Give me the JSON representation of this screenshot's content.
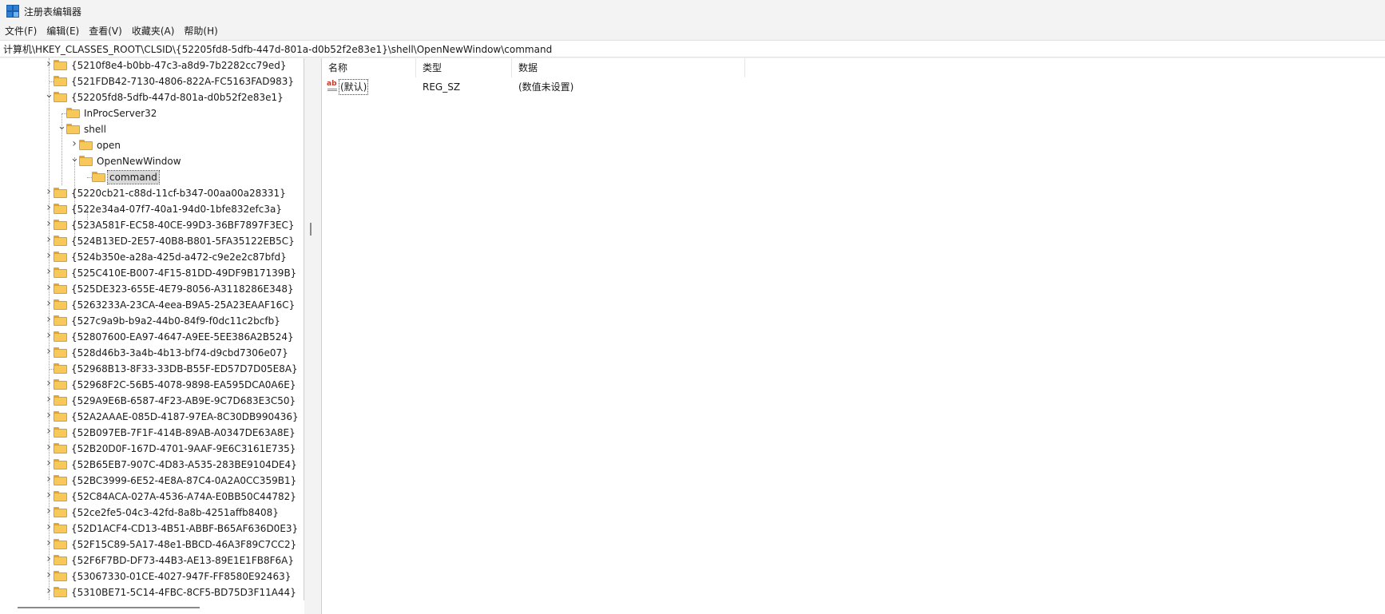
{
  "window": {
    "title": "注册表编辑器",
    "icon": "regedit-icon"
  },
  "menu": [
    "文件(F)",
    "编辑(E)",
    "查看(V)",
    "收藏夹(A)",
    "帮助(H)"
  ],
  "address": "计算机\\HKEY_CLASSES_ROOT\\CLSID\\{52205fd8-5dfb-447d-801a-d0b52f2e83e1}\\shell\\OpenNewWindow\\command",
  "tree": [
    {
      "label": "{5210f8e4-b0bb-47c3-a8d9-7b2282cc79ed}",
      "level": 0,
      "expander": "collapsed"
    },
    {
      "label": "{521FDB42-7130-4806-822A-FC5163FAD983}",
      "level": 0,
      "expander": "none"
    },
    {
      "label": "{52205fd8-5dfb-447d-801a-d0b52f2e83e1}",
      "level": 0,
      "expander": "expanded"
    },
    {
      "label": "InProcServer32",
      "level": 1,
      "expander": "none"
    },
    {
      "label": "shell",
      "level": 1,
      "expander": "expanded"
    },
    {
      "label": "open",
      "level": 2,
      "expander": "collapsed"
    },
    {
      "label": "OpenNewWindow",
      "level": 2,
      "expander": "expanded"
    },
    {
      "label": "command",
      "level": 3,
      "expander": "none",
      "selected": true
    },
    {
      "label": "{5220cb21-c88d-11cf-b347-00aa00a28331}",
      "level": 0,
      "expander": "collapsed"
    },
    {
      "label": "{522e34a4-07f7-40a1-94d0-1bfe832efc3a}",
      "level": 0,
      "expander": "collapsed"
    },
    {
      "label": "{523A581F-EC58-40CE-99D3-36BF7897F3EC}",
      "level": 0,
      "expander": "collapsed"
    },
    {
      "label": "{524B13ED-2E57-40B8-B801-5FA35122EB5C}",
      "level": 0,
      "expander": "collapsed"
    },
    {
      "label": "{524b350e-a28a-425d-a472-c9e2e2c87bfd}",
      "level": 0,
      "expander": "collapsed"
    },
    {
      "label": "{525C410E-B007-4F15-81DD-49DF9B17139B}",
      "level": 0,
      "expander": "collapsed"
    },
    {
      "label": "{525DE323-655E-4E79-8056-A3118286E348}",
      "level": 0,
      "expander": "collapsed"
    },
    {
      "label": "{5263233A-23CA-4eea-B9A5-25A23EAAF16C}",
      "level": 0,
      "expander": "collapsed"
    },
    {
      "label": "{527c9a9b-b9a2-44b0-84f9-f0dc11c2bcfb}",
      "level": 0,
      "expander": "collapsed"
    },
    {
      "label": "{52807600-EA97-4647-A9EE-5EE386A2B524}",
      "level": 0,
      "expander": "collapsed"
    },
    {
      "label": "{528d46b3-3a4b-4b13-bf74-d9cbd7306e07}",
      "level": 0,
      "expander": "collapsed"
    },
    {
      "label": "{52968B13-8F33-33DB-B55F-ED57D7D05E8A}",
      "level": 0,
      "expander": "none"
    },
    {
      "label": "{52968F2C-56B5-4078-9898-EA595DCA0A6E}",
      "level": 0,
      "expander": "collapsed"
    },
    {
      "label": "{529A9E6B-6587-4F23-AB9E-9C7D683E3C50}",
      "level": 0,
      "expander": "collapsed"
    },
    {
      "label": "{52A2AAAE-085D-4187-97EA-8C30DB990436}",
      "level": 0,
      "expander": "collapsed"
    },
    {
      "label": "{52B097EB-7F1F-414B-89AB-A0347DE63A8E}",
      "level": 0,
      "expander": "collapsed"
    },
    {
      "label": "{52B20D0F-167D-4701-9AAF-9E6C3161E735}",
      "level": 0,
      "expander": "collapsed"
    },
    {
      "label": "{52B65EB7-907C-4D83-A535-283BE9104DE4}",
      "level": 0,
      "expander": "collapsed"
    },
    {
      "label": "{52BC3999-6E52-4E8A-87C4-0A2A0CC359B1}",
      "level": 0,
      "expander": "collapsed"
    },
    {
      "label": "{52C84ACA-027A-4536-A74A-E0BB50C44782}",
      "level": 0,
      "expander": "collapsed"
    },
    {
      "label": "{52ce2fe5-04c3-42fd-8a8b-4251affb8408}",
      "level": 0,
      "expander": "collapsed"
    },
    {
      "label": "{52D1ACF4-CD13-4B51-ABBF-B65AF636D0E3}",
      "level": 0,
      "expander": "collapsed"
    },
    {
      "label": "{52F15C89-5A17-48e1-BBCD-46A3F89C7CC2}",
      "level": 0,
      "expander": "collapsed"
    },
    {
      "label": "{52F6F7BD-DF73-44B3-AE13-89E1E1FB8F6A}",
      "level": 0,
      "expander": "collapsed"
    },
    {
      "label": "{53067330-01CE-4027-947F-FF8580E92463}",
      "level": 0,
      "expander": "collapsed"
    },
    {
      "label": "{5310BE71-5C14-4FBC-8CF5-BD75D3F11A44}",
      "level": 0,
      "expander": "collapsed"
    }
  ],
  "list": {
    "columns": [
      "名称",
      "类型",
      "数据"
    ],
    "rows": [
      {
        "name": "(默认)",
        "type": "REG_SZ",
        "data": "(数值未设置)",
        "icon": "string-value-icon"
      }
    ]
  }
}
